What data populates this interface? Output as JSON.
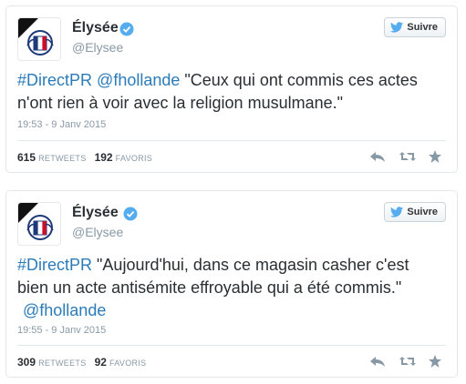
{
  "tweets": [
    {
      "name": "Élysée",
      "handle": "@Elysee",
      "follow_label": "Suivre",
      "text_link1": "#DirectPR",
      "text_link2": "@fhollande",
      "text_body": " \"Ceux qui ont commis ces actes n'ont rien à voir avec la religion musulmane.\"",
      "time": "19:53 - 9 Janv 2015",
      "retweets": "615",
      "retweets_label": "RETWEETS",
      "favorites": "192",
      "favorites_label": "FAVORIS"
    },
    {
      "name": "Élysée",
      "handle": "@Elysee",
      "follow_label": "Suivre",
      "text_link1": "#DirectPR",
      "text_body": " \"Aujourd'hui, dans ce magasin casher c'est bien un acte antisémite effroyable qui a été commis.\" ",
      "text_link2": "@fhollande",
      "time": "19:55 - 9 Janv 2015",
      "retweets": "309",
      "retweets_label": "RETWEETS",
      "favorites": "92",
      "favorites_label": "FAVORIS"
    }
  ],
  "colors": {
    "link": "#2b7bb9",
    "meta": "#8899a6",
    "verified": "#55acee",
    "twitter_bird": "#55acee"
  },
  "icons": [
    "avatar-logo",
    "verified-icon",
    "twitter-bird-icon",
    "reply-icon",
    "retweet-icon",
    "favorite-icon"
  ]
}
